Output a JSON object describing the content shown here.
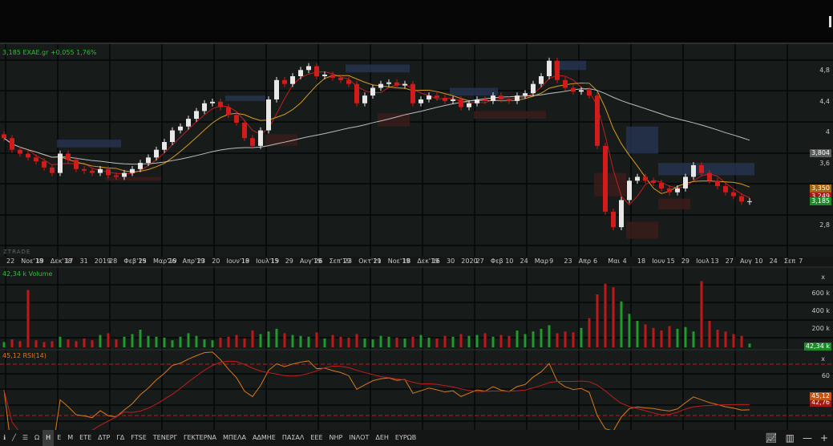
{
  "header": {
    "quote": "3,185 EXAE.gr +0,055 1,76%",
    "watermark": "ZTRADE"
  },
  "price_axis": {
    "ticks": [
      {
        "v": 4.8,
        "t": "4,8"
      },
      {
        "v": 4.4,
        "t": "4,4"
      },
      {
        "v": 4.0,
        "t": "4"
      },
      {
        "v": 3.6,
        "t": "3,6"
      },
      {
        "v": 2.8,
        "t": "2,8"
      }
    ],
    "tags": [
      {
        "v": 3.804,
        "t": "3,804",
        "color": "#5a5d5c"
      },
      {
        "v": 3.35,
        "t": "3,350",
        "color": "#a3660f"
      },
      {
        "v": 3.249,
        "t": "3,249",
        "color": "#a01818"
      },
      {
        "v": 3.185,
        "t": "3,185",
        "color": "#1d8a2a"
      }
    ]
  },
  "x_axis_labels": [
    "22",
    "Νοε'18",
    "19",
    "Δεκ'18",
    "17",
    "31",
    "2019",
    "28",
    "Φεβ'19",
    "25",
    "Μαρ'19",
    "26",
    "Απρ'19",
    "23",
    "20",
    "Ιουν'19",
    "18",
    "Ιουλ'19",
    "15",
    "29",
    "Αυγ'19",
    "26",
    "Σεπ'19",
    "23",
    "Οκτ'19",
    "21",
    "Νοε'19",
    "18",
    "Δεκ'19",
    "16",
    "30",
    "2020",
    "27",
    "Φεβ",
    "10",
    "24",
    "Μαρ",
    "9",
    "23",
    "Απρ",
    "6",
    "Μαι",
    "4",
    "18",
    "Ιουν",
    "15",
    "29",
    "Ιουλ",
    "13",
    "27",
    "Αυγ",
    "10",
    "24",
    "Σεπ",
    "7"
  ],
  "volume_panel": {
    "title": "42,34 k Volume",
    "close": "x",
    "ticks": [
      {
        "v": 600,
        "t": "600 k"
      },
      {
        "v": 400,
        "t": "400 k"
      },
      {
        "v": 200,
        "t": "200 k"
      }
    ],
    "tag": "42,34 k",
    "tag_color": "#1d8a2a"
  },
  "rsi_panel": {
    "title": "45,12 RSI(14)",
    "close": "x",
    "ticks": [
      {
        "v": 60,
        "t": "60"
      }
    ],
    "tag": "45,12",
    "tag2": "42,76",
    "tag_color": "#c2571a",
    "upper": 70,
    "lower": 30
  },
  "toolbar": {
    "items": [
      "Ω",
      "Η",
      "Ε",
      "Μ",
      "ΕΤΕ",
      "ΔΤΡ",
      "ΓΔ",
      "FTSE",
      "ΤΕΝΕΡΓ",
      "ΓΕΚΤΕΡΝΑ",
      "ΜΠΕΛΑ",
      "ΑΔΜΗΕ",
      "ΠΑΣΑΛ",
      "ΕΕΕ",
      "ΝΗΡ",
      "ΙΝΛΟΤ",
      "ΔΕΗ",
      "ΕΥΡΩΒ"
    ],
    "active": "Η"
  },
  "chart_data": {
    "type": "candlestick",
    "ylim": [
      2.6,
      5.1
    ],
    "closes": [
      4.0,
      3.85,
      3.8,
      3.75,
      3.7,
      3.62,
      3.55,
      3.8,
      3.72,
      3.6,
      3.58,
      3.55,
      3.6,
      3.52,
      3.5,
      3.55,
      3.6,
      3.68,
      3.75,
      3.85,
      3.95,
      4.1,
      4.15,
      4.25,
      4.35,
      4.45,
      4.47,
      4.4,
      4.3,
      4.2,
      4.0,
      3.9,
      4.1,
      4.5,
      4.75,
      4.7,
      4.8,
      4.88,
      4.93,
      4.8,
      4.82,
      4.78,
      4.75,
      4.7,
      4.45,
      4.55,
      4.65,
      4.7,
      4.72,
      4.68,
      4.7,
      4.45,
      4.5,
      4.55,
      4.52,
      4.48,
      4.5,
      4.4,
      4.45,
      4.5,
      4.48,
      4.55,
      4.5,
      4.48,
      4.55,
      4.58,
      4.7,
      4.8,
      5.0,
      4.75,
      4.65,
      4.6,
      4.62,
      4.55,
      3.9,
      3.05,
      2.85,
      3.2,
      3.45,
      3.5,
      3.45,
      3.42,
      3.35,
      3.3,
      3.35,
      3.5,
      3.65,
      3.55,
      3.45,
      3.38,
      3.3,
      3.25,
      3.18,
      3.185
    ],
    "volumes_k": [
      60,
      90,
      70,
      650,
      80,
      60,
      70,
      120,
      90,
      70,
      100,
      80,
      140,
      160,
      90,
      120,
      150,
      200,
      130,
      120,
      110,
      80,
      120,
      160,
      130,
      90,
      80,
      110,
      120,
      140,
      100,
      190,
      150,
      180,
      210,
      160,
      140,
      130,
      120,
      170,
      100,
      140,
      120,
      110,
      150,
      100,
      90,
      130,
      120,
      110,
      100,
      120,
      140,
      110,
      100,
      130,
      120,
      150,
      130,
      140,
      160,
      120,
      140,
      130,
      190,
      150,
      180,
      210,
      250,
      160,
      180,
      170,
      220,
      330,
      600,
      720,
      680,
      520,
      380,
      300,
      260,
      220,
      190,
      240,
      210,
      230,
      180,
      750,
      300,
      200,
      180,
      150,
      130,
      42.34
    ],
    "zones": [
      {
        "from": 7,
        "to": 15,
        "lo": 3.88,
        "hi": 3.98,
        "kind": "supply"
      },
      {
        "from": 13,
        "to": 20,
        "lo": 3.45,
        "hi": 3.5,
        "kind": "demand"
      },
      {
        "from": 28,
        "to": 33,
        "lo": 4.48,
        "hi": 4.55,
        "kind": "supply"
      },
      {
        "from": 33,
        "to": 37,
        "lo": 3.9,
        "hi": 4.05,
        "kind": "demand"
      },
      {
        "from": 43,
        "to": 51,
        "lo": 4.85,
        "hi": 4.95,
        "kind": "supply"
      },
      {
        "from": 47,
        "to": 51,
        "lo": 4.15,
        "hi": 4.32,
        "kind": "demand"
      },
      {
        "from": 56,
        "to": 62,
        "lo": 4.55,
        "hi": 4.65,
        "kind": "supply"
      },
      {
        "from": 59,
        "to": 68,
        "lo": 4.25,
        "hi": 4.35,
        "kind": "demand"
      },
      {
        "from": 69,
        "to": 73,
        "lo": 4.88,
        "hi": 5.0,
        "kind": "supply"
      },
      {
        "from": 74,
        "to": 78,
        "lo": 3.25,
        "hi": 3.55,
        "kind": "demand"
      },
      {
        "from": 78,
        "to": 82,
        "lo": 3.8,
        "hi": 4.15,
        "kind": "supply"
      },
      {
        "from": 78,
        "to": 82,
        "lo": 2.7,
        "hi": 2.92,
        "kind": "demand"
      },
      {
        "from": 82,
        "to": 94,
        "lo": 3.52,
        "hi": 3.68,
        "kind": "supply"
      },
      {
        "from": 82,
        "to": 86,
        "lo": 3.08,
        "hi": 3.22,
        "kind": "demand"
      }
    ],
    "ma_periods": [
      4,
      8,
      40
    ],
    "colors": {
      "up": "#e8e8e8",
      "down": "#d21b1b",
      "ma_fast": "#c21d1d",
      "ma_mid": "#d79a1f",
      "ma_slow": "#bdbdbd",
      "rsi": "#d97a1c",
      "rsi_ma": "#c21d1d"
    }
  }
}
